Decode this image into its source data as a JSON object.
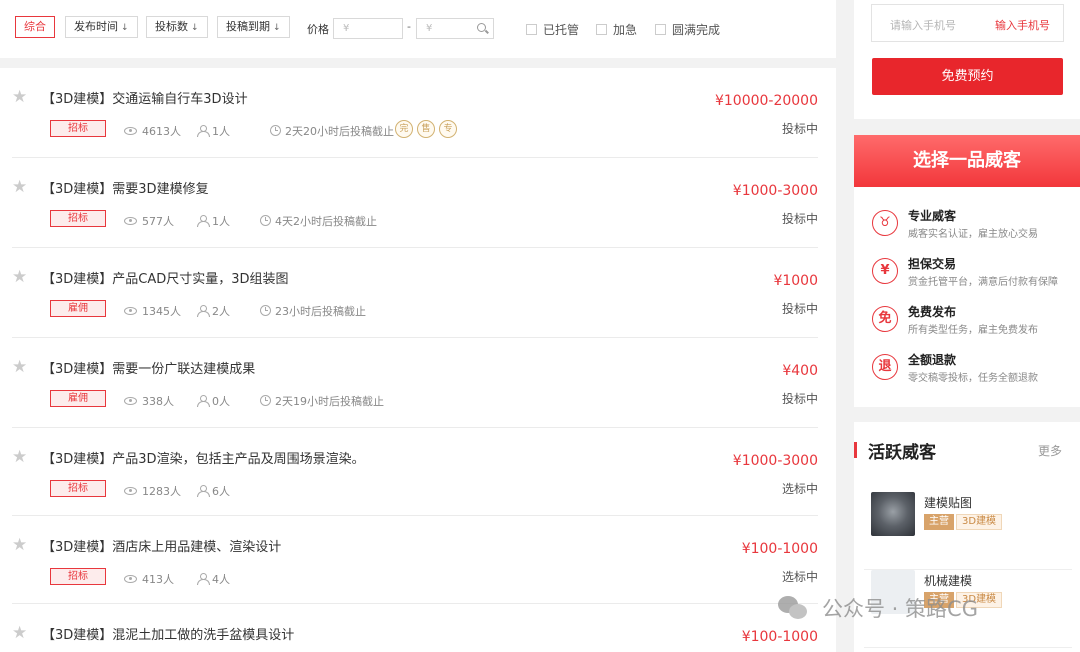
{
  "filters": {
    "sort": [
      {
        "label": "综合",
        "active": true,
        "arrow": ""
      },
      {
        "label": "发布时间",
        "active": false,
        "arrow": "↓"
      },
      {
        "label": "投标数",
        "active": false,
        "arrow": "↓"
      },
      {
        "label": "投稿到期",
        "active": false,
        "arrow": "↓"
      }
    ],
    "price_label": "价格",
    "price_min_placeholder": "¥",
    "price_sep": "-",
    "price_max_placeholder": "¥",
    "checks": [
      "已托管",
      "加急",
      "圆满完成"
    ]
  },
  "tasks": [
    {
      "title": "【3D建模】交通运输自行车3D设计",
      "badge": "招标",
      "views": "4613人",
      "bids": "1人",
      "deadline": "2天20小时后投稿截止",
      "price": "¥10000-20000",
      "status": "投标中",
      "marks": [
        "完",
        "售",
        "专"
      ]
    },
    {
      "title": "【3D建模】需要3D建模修复",
      "badge": "招标",
      "views": "577人",
      "bids": "1人",
      "deadline": "4天2小时后投稿截止",
      "price": "¥1000-3000",
      "status": "投标中",
      "marks": []
    },
    {
      "title": "【3D建模】产品CAD尺寸实量，3D组装图",
      "badge": "雇佣",
      "views": "1345人",
      "bids": "2人",
      "deadline": "23小时后投稿截止",
      "price": "¥1000",
      "status": "投标中",
      "marks": []
    },
    {
      "title": "【3D建模】需要一份广联达建模成果",
      "badge": "雇佣",
      "views": "338人",
      "bids": "0人",
      "deadline": "2天19小时后投稿截止",
      "price": "¥400",
      "status": "投标中",
      "marks": []
    },
    {
      "title": "【3D建模】产品3D渲染，包括主产品及周围场景渲染。",
      "badge": "招标",
      "views": "1283人",
      "bids": "6人",
      "deadline": "",
      "price": "¥1000-3000",
      "status": "选标中",
      "marks": []
    },
    {
      "title": "【3D建模】酒店床上用品建模、渲染设计",
      "badge": "招标",
      "views": "413人",
      "bids": "4人",
      "deadline": "",
      "price": "¥100-1000",
      "status": "选标中",
      "marks": []
    },
    {
      "title": "【3D建模】混泥土加工做的洗手盆模具设计",
      "badge": "",
      "views": "",
      "bids": "",
      "deadline": "",
      "price": "¥100-1000",
      "status": "",
      "marks": []
    }
  ],
  "sidebar": {
    "phone_placeholder": "请输入手机号",
    "phone_button": "输入手机号",
    "book_button": "免费预约",
    "banner": "选择一品威客",
    "features": [
      {
        "icon": "♉",
        "title": "专业威客",
        "desc": "威客实名认证，雇主放心交易"
      },
      {
        "icon": "¥",
        "title": "担保交易",
        "desc": "赏金托管平台，满意后付款有保障"
      },
      {
        "icon": "免",
        "title": "免费发布",
        "desc": "所有类型任务，雇主免费发布"
      },
      {
        "icon": "退",
        "title": "全额退款",
        "desc": "零交稿零投标，任务全额退款"
      }
    ],
    "active_title": "活跃威客",
    "active_more": "更多",
    "workers": [
      {
        "name": "建模贴图",
        "tag1": "主营",
        "tag2": "3D建模"
      },
      {
        "name": "机械建模",
        "tag1": "主营",
        "tag2": "3D建模"
      }
    ]
  },
  "watermark": "公众号 · 策路CG"
}
